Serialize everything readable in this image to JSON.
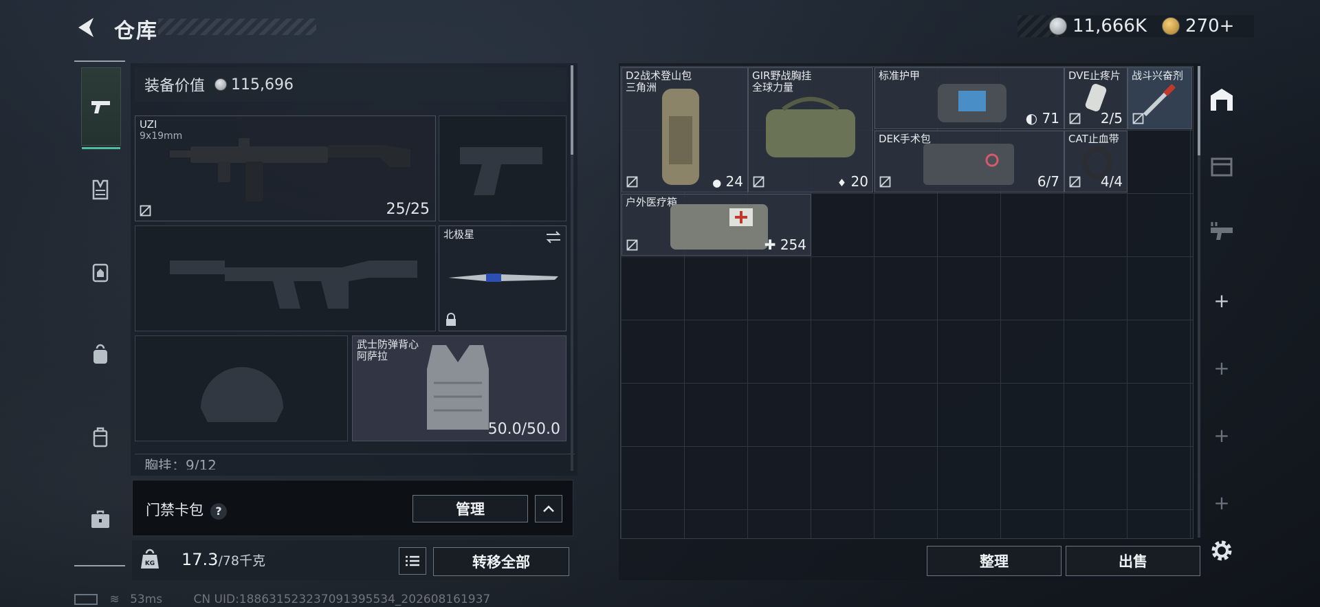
{
  "header": {
    "title": "仓库"
  },
  "currency": {
    "silver": "11,666K",
    "gold": "270+"
  },
  "equipment": {
    "value_label": "装备价值",
    "value": "115,696"
  },
  "slots": {
    "primary": {
      "name": "UZI",
      "sub": "9x19mm",
      "count": "25/25"
    },
    "melee": {
      "name": "北极星"
    },
    "armor": {
      "name": "武士防弹背心",
      "sub": "阿萨拉",
      "count": "50.0/50.0"
    },
    "chest_rig_partial": "胸挂：9/12"
  },
  "keycard": {
    "label": "门禁卡包",
    "help": "?",
    "manage": "管理"
  },
  "weight": {
    "value": "17.3",
    "unit": "/78千克",
    "transfer_all": "转移全部"
  },
  "items": [
    {
      "name": "D2战术登山包",
      "sub": "三角洲",
      "count": "24"
    },
    {
      "name": "GIR野战胸挂",
      "sub": "全球力量",
      "count": "20"
    },
    {
      "name": "标准护甲",
      "count": "71"
    },
    {
      "name": "DVE止疼片",
      "count": "2/5"
    },
    {
      "name": "战斗兴奋剂"
    },
    {
      "name": "DEK手术包",
      "count": "6/7"
    },
    {
      "name": "CAT止血带",
      "count": "4/4"
    },
    {
      "name": "户外医疗箱",
      "count": "254"
    }
  ],
  "actions": {
    "organize": "整理",
    "sell": "出售"
  },
  "status": {
    "ping": "53ms",
    "uid": "CN UID:188631523237091395534_202608161937"
  },
  "icons": [
    "back-arrow-icon",
    "pistol-icon",
    "vest-icon",
    "backpack-icon",
    "helmet-icon",
    "case-icon",
    "toolbox-icon",
    "gear-icon",
    "lock-icon",
    "swap-icon"
  ]
}
